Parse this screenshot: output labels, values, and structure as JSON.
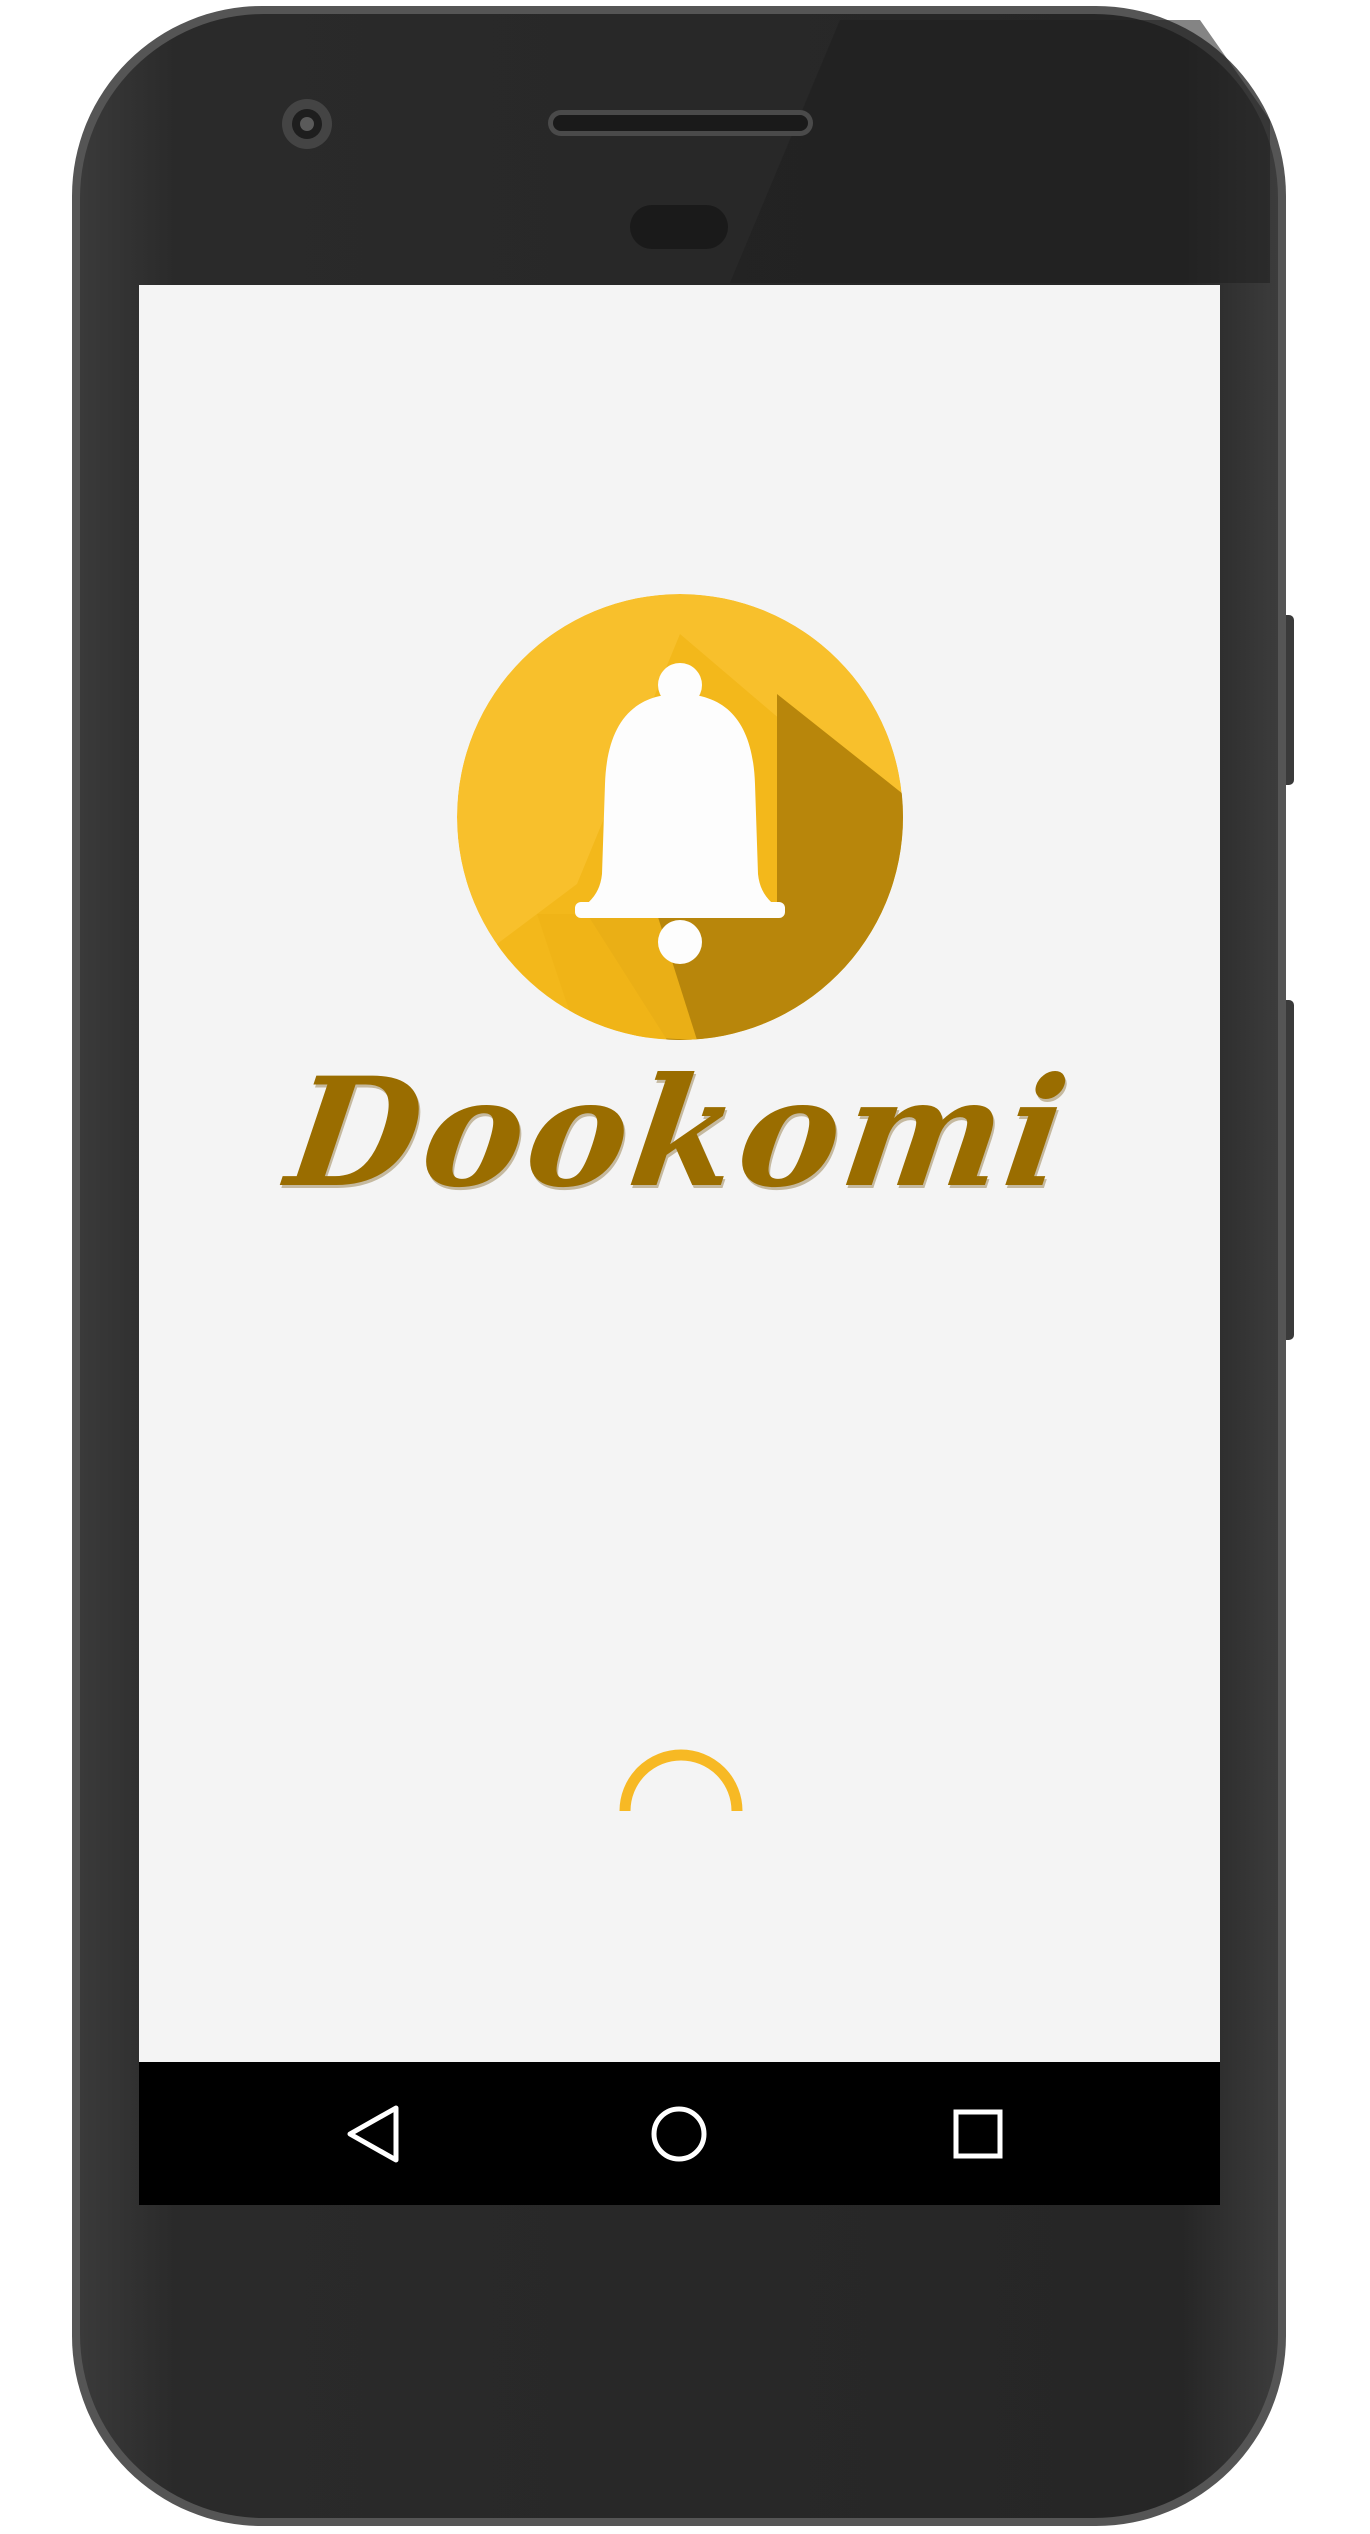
{
  "app": {
    "name": "Dookomi"
  },
  "icons": {
    "logo": "bell-icon",
    "loading": "loading-spinner",
    "nav_back": "back-triangle-icon",
    "nav_home": "home-circle-icon",
    "nav_recents": "recents-square-icon"
  },
  "colors": {
    "screen_background": "#f4f4f4",
    "logo_primary": "#f7b924",
    "logo_shadow": "#b8860b",
    "brand_text": "#9a6d00",
    "spinner": "#f7b924",
    "navbar": "#000000",
    "device_body": "#2b2b2b"
  }
}
